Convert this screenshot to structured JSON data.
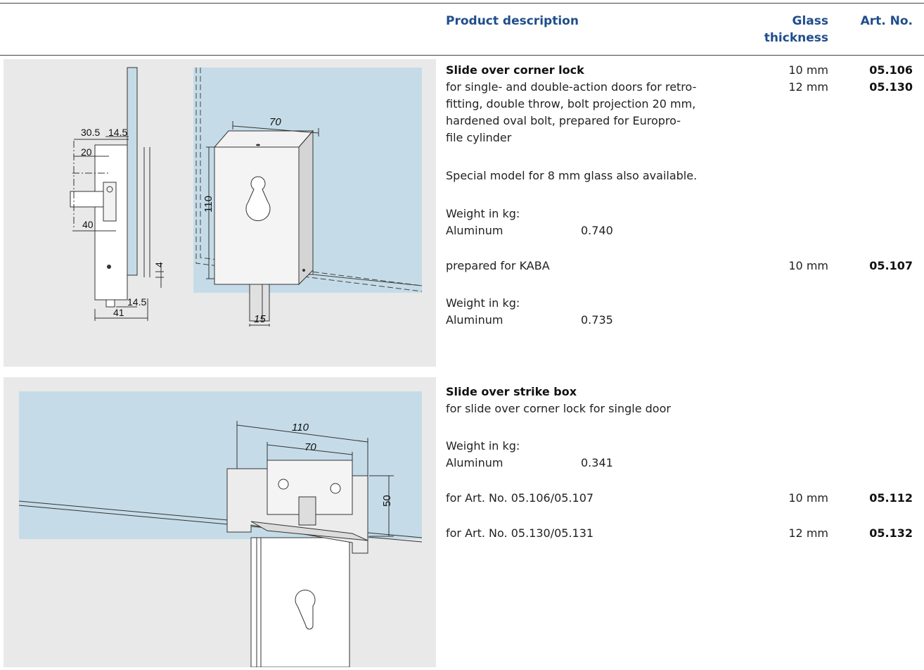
{
  "header": {
    "product_description": "Product description",
    "glass_thickness_line1": "Glass",
    "glass_thickness_line2": "thickness",
    "art_no": "Art. No."
  },
  "section1": {
    "title": "Slide over corner lock",
    "desc_lines": [
      "for single- and double-action doors for retro-",
      "fitting, double throw, bolt projection 20 mm,",
      "hardened oval bolt, prepared for Europro-",
      "file cylinder"
    ],
    "special_note": "Special model for 8 mm glass also available.",
    "weight_label_1": "Weight in kg:",
    "material_1": "Aluminum",
    "weight_value_1": "0.740",
    "thickness_1": "10 mm",
    "artno_1": "05.106",
    "thickness_2": "12 mm",
    "artno_2": "05.130",
    "kaba_label": "prepared for KABA",
    "kaba_thickness": "10 mm",
    "kaba_artno": "05.107",
    "weight_label_2": "Weight in kg:",
    "material_2": "Aluminum",
    "weight_value_2": "0.735"
  },
  "section2": {
    "title": "Slide over strike box",
    "desc": "for slide over corner lock for single door",
    "weight_label": "Weight in kg:",
    "material": "Aluminum",
    "weight_value": "0.341",
    "row1_label": "for Art. No. 05.106/05.107",
    "row1_thickness": "10 mm",
    "row1_artno": "05.112",
    "row2_label": "for Art. No. 05.130/05.131",
    "row2_thickness": "12 mm",
    "row2_artno": "05.132"
  },
  "drawing1": {
    "dim_30_5": "30.5",
    "dim_14_5_top": "14.5",
    "dim_20": "20",
    "dim_40": "40",
    "dim_4": "4",
    "dim_14_5_bottom": "14.5",
    "dim_41": "41",
    "dim_70": "70",
    "dim_110": "110",
    "dim_15": "15"
  },
  "drawing2": {
    "dim_110": "110",
    "dim_70": "70",
    "dim_50": "50"
  },
  "colors": {
    "heading_blue": "#1f4e8c",
    "glass_blue": "#c5dce8",
    "panel_grey": "#e9e9e9"
  }
}
